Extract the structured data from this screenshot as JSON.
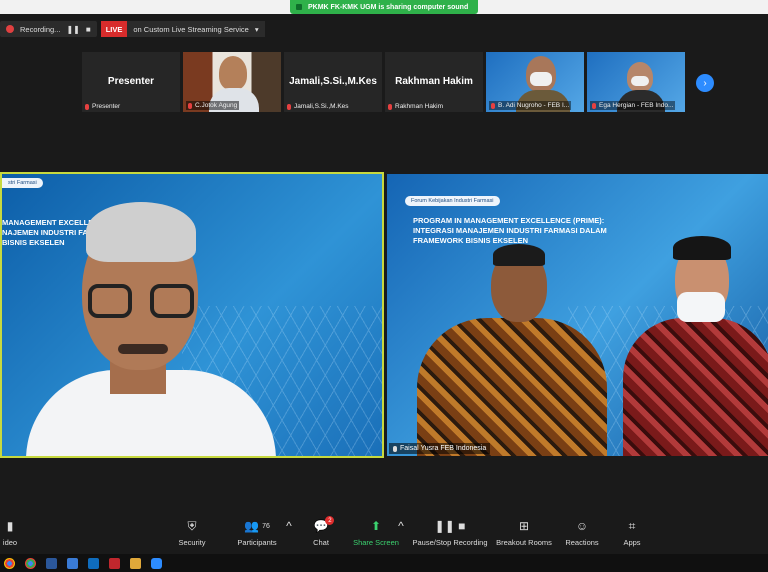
{
  "share_banner": {
    "text": "PKMK FK-KMK UGM is sharing computer sound"
  },
  "recording": {
    "label": "Recording...",
    "pause": "❚❚",
    "stop": "■"
  },
  "live": {
    "badge": "LIVE",
    "service": "on Custom Live Streaming Service",
    "caret": "▾"
  },
  "participants_strip": [
    {
      "big": "Presenter",
      "label": "Presenter"
    },
    {
      "big": "",
      "label": "C.Jotok Agung"
    },
    {
      "big": "Jamali,S.Si.,M.Kes",
      "label": "Jamali,S.Si.,M.Kes"
    },
    {
      "big": "Rakhman Hakim",
      "label": "Rakhman Hakim"
    },
    {
      "big": "",
      "label": "B. Adi Nugroho - FEB I..."
    },
    {
      "big": "",
      "label": "Ega Hergian - FEB Indo..."
    }
  ],
  "next_icon": "›",
  "left_video": {
    "tag": "stri Farmasi",
    "slide_lines": [
      "MANAGEMENT EXCELLENCE (P",
      "NAJEMEN INDUSTRI FARMA",
      "BISNIS EKSELEN"
    ]
  },
  "right_video": {
    "tag": "Forum Kebijakan Industri Farmasi",
    "slide_lines": [
      "PROGRAM IN MANAGEMENT EXCELLENCE (PRIME):",
      "INTEGRASI MANAJEMEN INDUSTRI FARMASI DALAM",
      "FRAMEWORK BISNIS EKSELEN"
    ],
    "name": "Faisal Yusra FEB Indonesia"
  },
  "toolbar": {
    "video": "ideo",
    "security": "Security",
    "participants": "Participants",
    "participants_count": "76",
    "chat": "Chat",
    "chat_badge": "2",
    "share": "Share Screen",
    "record": "Pause/Stop Recording",
    "breakout": "Breakout Rooms",
    "reactions": "Reactions",
    "apps": "Apps",
    "caret": "^"
  },
  "colors": {
    "accent": "#2d8cff",
    "share_green": "#2fb14a",
    "live_red": "#d82c2c",
    "speaker_border": "#c7d93f"
  }
}
